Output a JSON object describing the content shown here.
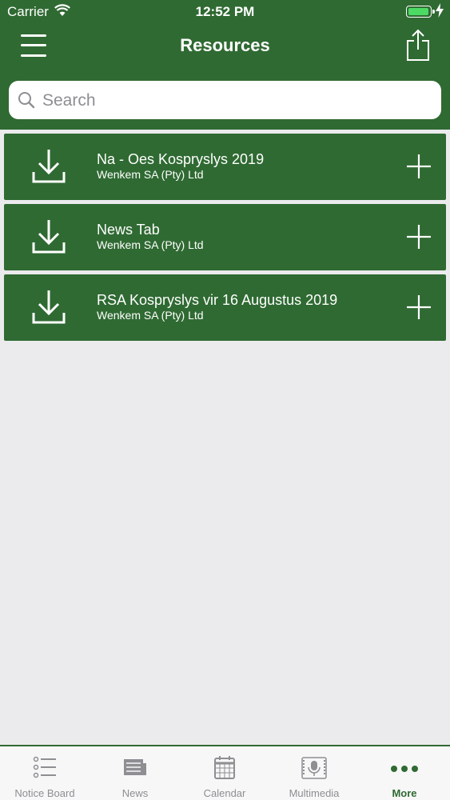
{
  "status_bar": {
    "carrier": "Carrier",
    "time": "12:52 PM",
    "battery_level": 1.0
  },
  "header": {
    "title": "Resources"
  },
  "search": {
    "placeholder": "Search",
    "value": ""
  },
  "resources": [
    {
      "title": "Na - Oes Kospryslys 2019",
      "subtitle": "Wenkem SA (Pty) Ltd"
    },
    {
      "title": "News Tab",
      "subtitle": "Wenkem SA (Pty) Ltd"
    },
    {
      "title": "RSA Kospryslys vir 16 Augustus 2019",
      "subtitle": "Wenkem SA (Pty) Ltd"
    }
  ],
  "tabs": [
    {
      "label": "Notice Board",
      "icon": "list-icon"
    },
    {
      "label": "News",
      "icon": "newspaper-icon"
    },
    {
      "label": "Calendar",
      "icon": "calendar-icon"
    },
    {
      "label": "Multimedia",
      "icon": "microphone-icon"
    },
    {
      "label": "More",
      "icon": "more-icon",
      "active": true
    }
  ],
  "colors": {
    "brand": "#2f6a32",
    "background": "#ebebed",
    "inactive_tab": "#8e8e93"
  }
}
